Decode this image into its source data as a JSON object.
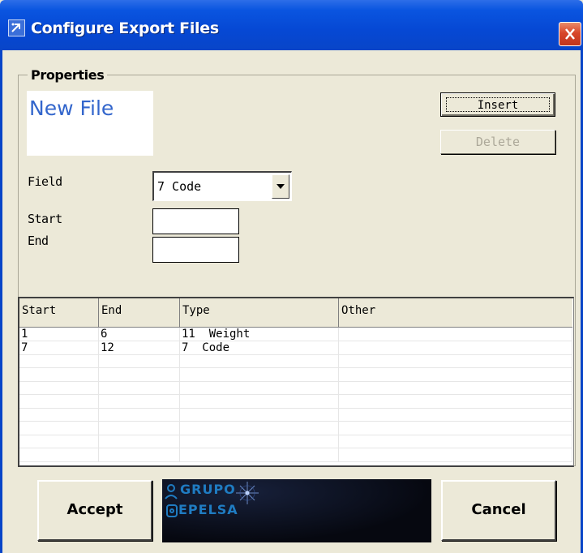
{
  "window": {
    "title": "Configure Export Files",
    "title_icon": "app-icon",
    "close_icon": "close-icon"
  },
  "properties": {
    "legend": "Properties",
    "name": "New File",
    "insert_label": "Insert",
    "delete_label": "Delete",
    "field_label": "Field",
    "field_value": "7  Code",
    "start_label": "Start",
    "end_label": "End",
    "start_value": "",
    "end_value": ""
  },
  "table": {
    "headers": [
      "Start",
      "End",
      "Type",
      "Other"
    ],
    "rows": [
      [
        "1",
        "6",
        "11  Weight",
        ""
      ],
      [
        "7",
        "12",
        "7  Code",
        ""
      ],
      [
        "",
        "",
        "",
        ""
      ],
      [
        "",
        "",
        "",
        ""
      ],
      [
        "",
        "",
        "",
        ""
      ],
      [
        "",
        "",
        "",
        ""
      ],
      [
        "",
        "",
        "",
        ""
      ],
      [
        "",
        "",
        "",
        ""
      ],
      [
        "",
        "",
        "",
        ""
      ],
      [
        "",
        "",
        "",
        ""
      ]
    ]
  },
  "footer": {
    "accept_label": "Accept",
    "cancel_label": "Cancel",
    "logo_line1": "GRUPO",
    "logo_line2": "EPELSA"
  },
  "colors": {
    "title_bar": "#0845c8",
    "close_button": "#d8462a",
    "accent_text": "#3366cc",
    "window_bg": "#ece9d8"
  }
}
